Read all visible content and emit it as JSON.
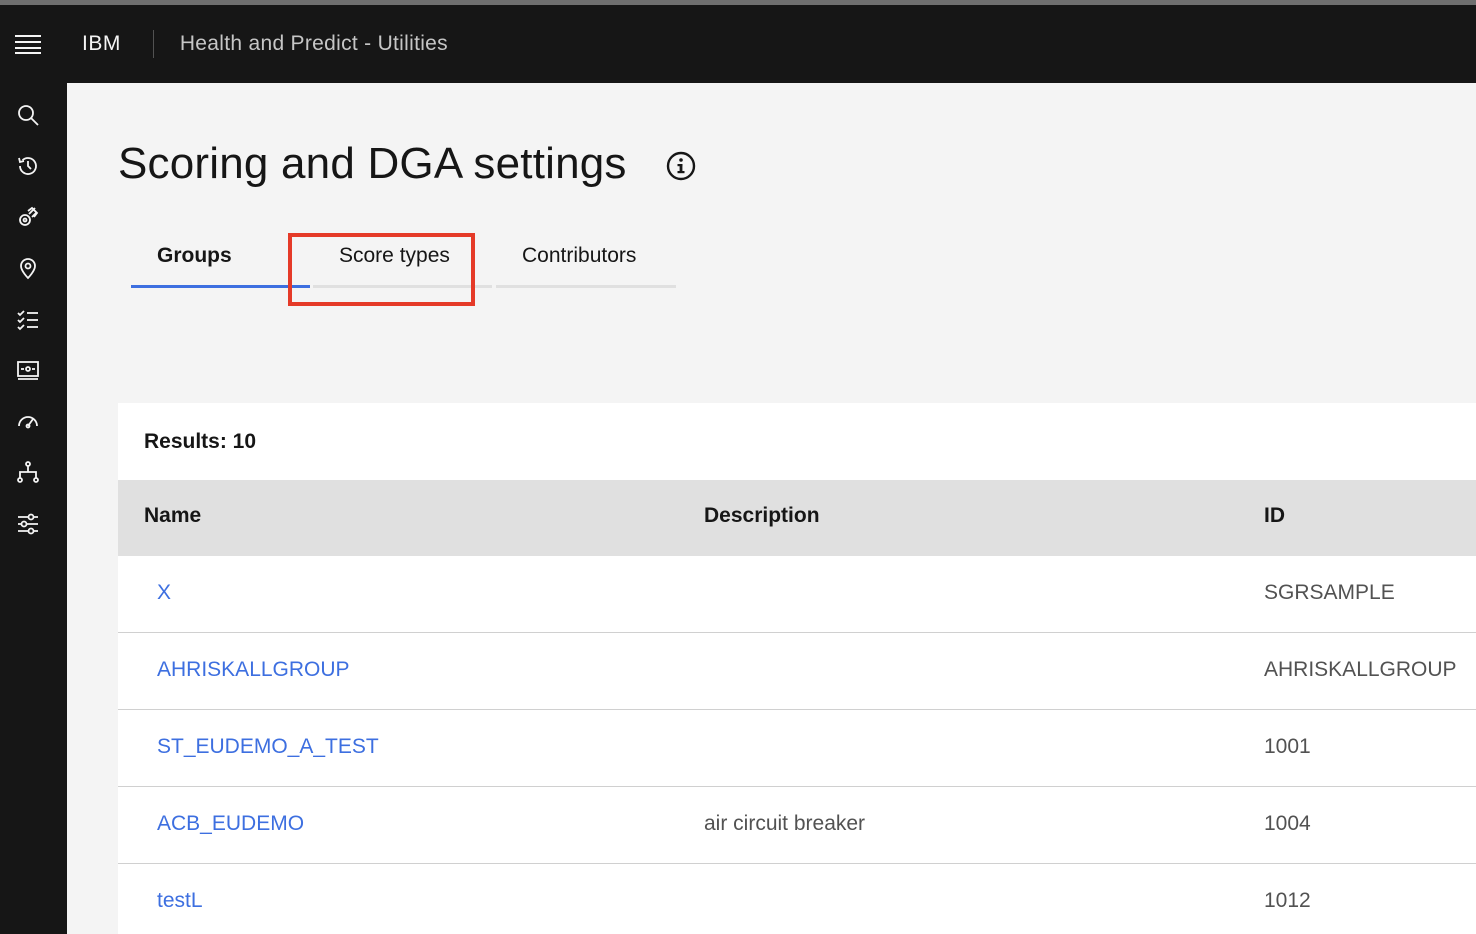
{
  "header": {
    "brand": "IBM",
    "product": "Health and Predict - Utilities"
  },
  "sidenav": {
    "items": [
      {
        "icon": "search-icon"
      },
      {
        "icon": "history-icon"
      },
      {
        "icon": "satellite-icon"
      },
      {
        "icon": "location-icon"
      },
      {
        "icon": "checklist-icon"
      },
      {
        "icon": "dashboard-icon"
      },
      {
        "icon": "meter-icon"
      },
      {
        "icon": "hierarchy-icon"
      },
      {
        "icon": "sliders-icon"
      }
    ]
  },
  "page": {
    "title": "Scoring and DGA settings"
  },
  "tabs": [
    {
      "label": "Groups",
      "active": true
    },
    {
      "label": "Score types",
      "active": false
    },
    {
      "label": "Contributors",
      "active": false
    }
  ],
  "table": {
    "results": "Results: 10",
    "columns": [
      "Name",
      "Description",
      "ID"
    ],
    "rows": [
      {
        "name": "X",
        "description": "",
        "id": "SGRSAMPLE"
      },
      {
        "name": "AHRISKALLGROUP",
        "description": "",
        "id": "AHRISKALLGROUP"
      },
      {
        "name": "ST_EUDEMO_A_TEST",
        "description": "",
        "id": "1001"
      },
      {
        "name": "ACB_EUDEMO",
        "description": "air circuit breaker",
        "id": "1004"
      },
      {
        "name": "testL",
        "description": "",
        "id": "1012"
      }
    ]
  },
  "colors": {
    "header_bg": "#161616",
    "accent": "#3d6fe0",
    "highlight": "#e53a28"
  }
}
